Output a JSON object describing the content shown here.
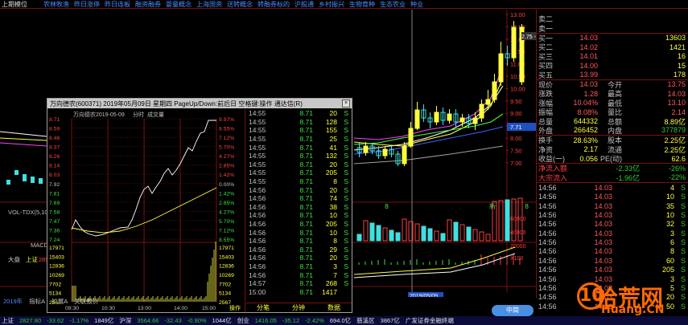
{
  "topbar": {
    "stock": "上期模位",
    "tags": [
      "农林牧渔",
      "昨日涨停",
      "昨日连板",
      "融资融券",
      "婴童概念",
      "上海国资",
      "送转概念",
      "转融券标的",
      "沪股通",
      "乡村振兴",
      "生物育种",
      "生态农业",
      "种业"
    ]
  },
  "main_chart": {
    "price_axis": [
      "13.00",
      "12.50",
      "12.00",
      "11.50",
      "11.00",
      "10.50",
      "10.00",
      "9.50",
      "9.00",
      "8.50",
      "8.00",
      "7.50",
      "7.00"
    ],
    "vol_axis": [
      "60000",
      "40000",
      "20000",
      "X100"
    ],
    "annotation": "2.75 - 13.",
    "highlight_label": "7.71",
    "date_label": "2019/05/09",
    "vol_label": "VOL-TDX(5,10)",
    "macd_label": "MACD",
    "legend_left": [
      "大盘",
      "上证",
      "285"
    ],
    "row_markers": [
      "8",
      "新",
      "8"
    ]
  },
  "popup": {
    "title": "万向德农(600371) 2019年05月09日 星期四 PageUp/Down:前后日 空格键:操作 通达信(R)",
    "close": "×",
    "chart_header_name": "万向德农",
    "chart_header_date": "2019-05-09",
    "chart_header_tabs": [
      "分时",
      "成交量"
    ],
    "price_left": [
      "8.71",
      "8.59",
      "8.48",
      "8.37",
      "8.26",
      "8.14",
      "8.03",
      "7.92",
      "7.81",
      "7.69",
      "7.58",
      "7.47",
      "7.36",
      "7.24"
    ],
    "price_right": [
      "9.97%",
      "8.55%",
      "7.12%",
      "5.70%",
      "4.27%",
      "2.85%",
      "1.42%",
      "0.00%",
      "1.42%",
      "2.85%",
      "4.27%",
      "5.70%",
      "7.12%",
      "8.55%"
    ],
    "vol_left": [
      "17971",
      "15403",
      "12836",
      "10269",
      "7702",
      "5134",
      "2567"
    ],
    "vol_right": [
      "17971",
      "15403",
      "12836",
      "10269",
      "7702",
      "5134",
      "2567"
    ],
    "x_axis": [
      "09:30",
      "10:30",
      "13:00",
      "14:00",
      "15:00"
    ],
    "x_tab": "操作",
    "ticks": [
      {
        "t": "14:55",
        "p": "8.71",
        "v": "20",
        "s": "S"
      },
      {
        "t": "14:55",
        "p": "8.71",
        "v": "128",
        "s": "S"
      },
      {
        "t": "14:55",
        "p": "8.71",
        "v": "155",
        "s": "S"
      },
      {
        "t": "14:55",
        "p": "8.71",
        "v": "25",
        "s": "S"
      },
      {
        "t": "14:55",
        "p": "8.71",
        "v": "41",
        "s": "S"
      },
      {
        "t": "14:55",
        "p": "8.71",
        "v": "132",
        "s": "S"
      },
      {
        "t": "14:55",
        "p": "8.71",
        "v": "20",
        "s": "S"
      },
      {
        "t": "14:55",
        "p": "8.71",
        "v": "205",
        "s": "S"
      },
      {
        "t": "14:55",
        "p": "8.71",
        "v": "8",
        "s": "S"
      },
      {
        "t": "14:56",
        "p": "8.71",
        "v": "20",
        "s": "S"
      },
      {
        "t": "14:56",
        "p": "8.71",
        "v": "74",
        "s": "S"
      },
      {
        "t": "14:56",
        "p": "8.71",
        "v": "38",
        "s": "S"
      },
      {
        "t": "14:56",
        "p": "8.71",
        "v": "10",
        "s": "S"
      },
      {
        "t": "14:56",
        "p": "8.71",
        "v": "205",
        "s": "S"
      },
      {
        "t": "14:56",
        "p": "8.71",
        "v": "10",
        "s": "S"
      },
      {
        "t": "14:56",
        "p": "8.71",
        "v": "8",
        "s": "S"
      },
      {
        "t": "14:56",
        "p": "8.71",
        "v": "29",
        "s": "S"
      },
      {
        "t": "14:56",
        "p": "8.71",
        "v": "20",
        "s": "S"
      },
      {
        "t": "14:56",
        "p": "8.71",
        "v": "3",
        "s": "S"
      },
      {
        "t": "14:56",
        "p": "8.71",
        "v": "7",
        "s": "S"
      },
      {
        "t": "14:57",
        "p": "8.71",
        "v": "268",
        "s": "S"
      },
      {
        "t": "15:00",
        "p": "8.71",
        "v": "1417",
        "s": ""
      }
    ],
    "tabs": [
      "分笔",
      "分钟",
      "数据"
    ]
  },
  "quote": {
    "sell": [
      {
        "label": "卖二",
        "price": "",
        "vol": ""
      },
      {
        "label": "卖一",
        "price": "",
        "vol": ""
      }
    ],
    "buy": [
      {
        "label": "买一",
        "price": "14.03",
        "vol": "13603"
      },
      {
        "label": "买二",
        "price": "14.02",
        "vol": "1421"
      },
      {
        "label": "买三",
        "price": "14.01",
        "vol": "16"
      },
      {
        "label": "买四",
        "price": "14.00",
        "vol": "15"
      },
      {
        "label": "买五",
        "price": "13.99",
        "vol": "178"
      }
    ],
    "stats": [
      {
        "l1": "现价",
        "v1": "14.03",
        "l2": "今开",
        "v2": "13.75"
      },
      {
        "l1": "涨跌",
        "v1": "1.28",
        "l2": "最高",
        "v2": "14.03"
      },
      {
        "l1": "涨幅",
        "v1": "10.04%",
        "l2": "最低",
        "v2": "13.10"
      },
      {
        "l1": "振幅",
        "v1": "8.08%",
        "l2": "量比",
        "v2": "2.14"
      },
      {
        "l1": "总量",
        "v1": "644332",
        "l2": "总额",
        "v2": "8.89亿"
      },
      {
        "l1": "外盘",
        "v1": "266452",
        "l2": "内盘",
        "v2": "377879"
      }
    ],
    "fin": [
      {
        "l1": "换手",
        "v1": "28.63%",
        "l2": "股本",
        "v2": "2.25亿"
      },
      {
        "l1": "净资",
        "v1": "2.17",
        "l2": "流通",
        "v2": "2.25亿"
      },
      {
        "l1": "收益(一)",
        "v1": "0.056",
        "l2": "PE(动)",
        "v2": "62.6"
      }
    ],
    "flow": [
      {
        "l": "净流入额",
        "v": "-2.33亿",
        "p": "-26%"
      },
      {
        "l": "大宗流入",
        "v": "-1.96亿",
        "p": "-22%"
      }
    ],
    "trades": [
      {
        "t": "14:56",
        "p": "14.03",
        "v": "4",
        "s": "S"
      },
      {
        "t": "14:56",
        "p": "14.03",
        "v": "10",
        "s": "S"
      },
      {
        "t": "14:56",
        "p": "14.03",
        "v": "35",
        "s": "S"
      },
      {
        "t": "14:56",
        "p": "14.03",
        "v": "10",
        "s": "S"
      },
      {
        "t": "14:56",
        "p": "14.03",
        "v": "32",
        "s": "S"
      },
      {
        "t": "14:56",
        "p": "14.03",
        "v": "3",
        "s": "S"
      },
      {
        "t": "14:56",
        "p": "14.03",
        "v": "6",
        "s": "S"
      },
      {
        "t": "14:56",
        "p": "14.03",
        "v": "8",
        "s": "S"
      },
      {
        "t": "14:56",
        "p": "14.03",
        "v": "60",
        "s": "S"
      },
      {
        "t": "14:56",
        "p": "14.03",
        "v": "205",
        "s": "S"
      },
      {
        "t": "14:56",
        "p": "14.03",
        "v": "3",
        "s": "S"
      },
      {
        "t": "14:56",
        "p": "14.03",
        "v": "5",
        "s": "S"
      },
      {
        "t": "14:56",
        "p": "14.03",
        "v": "20",
        "s": "S"
      },
      {
        "t": "14:56",
        "p": "14.03",
        "v": "50",
        "s": "S"
      }
    ]
  },
  "bottom_tabs": [
    "2019年",
    "指标A",
    "扩展A",
    "关联报价"
  ],
  "status": {
    "items": [
      {
        "label": "上证",
        "value": "2827.80",
        "chg": "-33.62",
        "pct": "-1.17%",
        "amt": "1849亿"
      },
      {
        "label": "沪深",
        "value": "3564.66",
        "chg": "-32.43",
        "pct": "-0.90%",
        "amt": "1044亿"
      },
      {
        "label": "创业",
        "value": "1416.05",
        "chg": "-35.12",
        "pct": "-2.42%",
        "amt": "694.0亿"
      }
    ],
    "extra": [
      "慈溪区",
      "3867亿",
      "广发证券金融终端"
    ]
  },
  "watermark": {
    "dot": "10",
    "text": "拾荒网",
    "site": "Huang.CN"
  },
  "ime": {
    "label": "中简"
  },
  "colors": {
    "up": "#ff4040",
    "down": "#34c834",
    "accent": "#ffff40",
    "border": "#7a1010",
    "candle_up": "#ffff40"
  }
}
